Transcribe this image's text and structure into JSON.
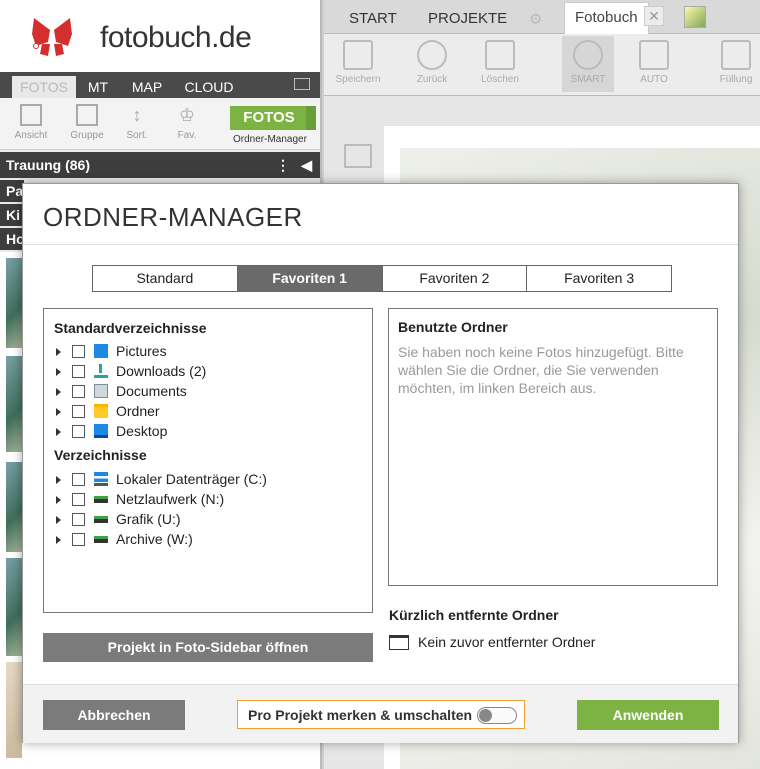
{
  "app": {
    "logo_text": "fotobuch.de"
  },
  "left_panel": {
    "tabs": [
      {
        "label": "FOTOS",
        "active": true
      },
      {
        "label": "MT"
      },
      {
        "label": "MAP"
      },
      {
        "label": "CLOUD"
      }
    ],
    "toolbar": {
      "ansicht": "Ansicht",
      "gruppe": "Gruppe",
      "sort": "Sort.",
      "fav": "Fav.",
      "fotos_button": "FOTOS",
      "ordner_manager": "Ordner-Manager"
    },
    "album_header": "Trauung (86)",
    "album_rows": [
      "Pa",
      "Ki",
      "Ho"
    ]
  },
  "right_area": {
    "tabs": {
      "start": "START",
      "projekte": "PROJEKTE",
      "fotobuch": "Fotobuch"
    },
    "toolbar": {
      "speichern": "Speichern",
      "zurueck": "Zurück",
      "loeschen": "Löschen",
      "smart": "SMART",
      "auto": "AUTO",
      "fuellung": "Füllung"
    }
  },
  "modal": {
    "title": "ORDNER-MANAGER",
    "tabs": [
      {
        "label": "Standard",
        "active": false
      },
      {
        "label": "Favoriten 1",
        "active": true
      },
      {
        "label": "Favoriten 2",
        "active": false
      },
      {
        "label": "Favoriten 3",
        "active": false
      }
    ],
    "standard_section_title": "Standardverzeichnisse",
    "standard_folders": [
      {
        "label": "Pictures",
        "icon": "pictures-icon"
      },
      {
        "label": "Downloads (2)",
        "icon": "downloads-icon"
      },
      {
        "label": "Documents",
        "icon": "documents-icon"
      },
      {
        "label": "Ordner",
        "icon": "folder-icon"
      },
      {
        "label": "Desktop",
        "icon": "desktop-icon"
      }
    ],
    "dirs_section_title": "Verzeichnisse",
    "directories": [
      {
        "label": "Lokaler Datenträger (C:)",
        "icon": "local-drive-icon"
      },
      {
        "label": "Netzlaufwerk (N:)",
        "icon": "network-drive-icon"
      },
      {
        "label": "Grafik (U:)",
        "icon": "network-drive-icon"
      },
      {
        "label": "Archive (W:)",
        "icon": "network-drive-icon"
      }
    ],
    "open_project_button": "Projekt in Foto-Sidebar öffnen",
    "used_folders_title": "Benutzte Ordner",
    "used_folders_empty_text": "Sie haben noch keine Fotos hinzugefügt. Bitte wählen Sie die Ordner, die Sie verwenden möchten, im linken Bereich aus.",
    "recent_title": "Kürzlich entfernte Ordner",
    "recent_empty_text": "Kein zuvor entfernter Ordner",
    "cancel_button": "Abbrechen",
    "toggle_label": "Pro Projekt merken & umschalten",
    "toggle_on": false,
    "apply_button": "Anwenden"
  },
  "colors": {
    "accent_green": "#7cb342",
    "toggle_border": "#f0a030",
    "logo_red": "#d32f2f"
  }
}
